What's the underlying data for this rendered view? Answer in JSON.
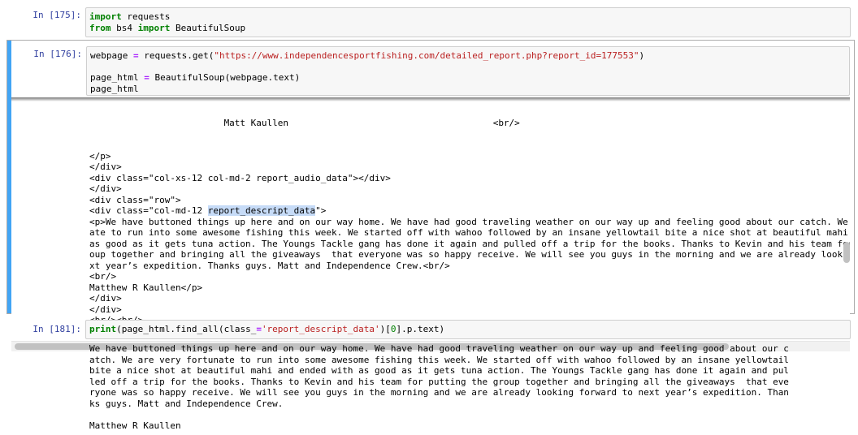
{
  "cells": [
    {
      "prompt": "In [175]:",
      "code": [
        [
          {
            "t": "import",
            "c": "kw"
          },
          {
            "t": " requests"
          }
        ],
        [
          {
            "t": "from",
            "c": "kw"
          },
          {
            "t": " bs4 "
          },
          {
            "t": "import",
            "c": "kw"
          },
          {
            "t": " BeautifulSoup"
          }
        ]
      ]
    },
    {
      "prompt": "In [176]:",
      "code": [
        [
          {
            "t": "webpage "
          },
          {
            "t": "=",
            "c": "op"
          },
          {
            "t": " requests.get("
          },
          {
            "t": "\"https://www.independencesportfishing.com/detailed_report.php?report_id=177553\"",
            "c": "str"
          },
          {
            "t": ")"
          }
        ],
        [
          {
            "t": ""
          }
        ],
        [
          {
            "t": "page_html "
          },
          {
            "t": "=",
            "c": "op"
          },
          {
            "t": " BeautifulSoup(webpage.text)"
          }
        ],
        [
          {
            "t": "page_html"
          }
        ]
      ],
      "output_partial_line": "                         Matt Kaullen                                      <br/>",
      "output_lines": [
        "</p>",
        "</div>",
        "<div class=\"col-xs-12 col-md-2 report_audio_data\"></div>",
        "</div>",
        "<div class=\"row\">",
        "<div class=\"col-md-12 ",
        "<p>We have buttoned things up here and on our way home. We have had good traveling weather on our way up and feeling good about our catch. We are very fortun",
        "ate to run into some awesome fishing this week. We started off with wahoo followed by an insane yellowtail bite a nice shot at beautiful mahi and ended with",
        "as good as it gets tuna action. The Youngs Tackle gang has done it again and pulled off a trip for the books. Thanks to Kevin and his team for putting the gr",
        "oup together and bringing all the giveaways  that everyone was so happy receive. We will see you guys in the morning and we are already looking forward to ne",
        "xt year’s expedition. Thanks guys. Matt and Independence Crew.<br/>",
        "<br/>",
        "Matthew R Kaullen</p>",
        "</div>",
        "</div>",
        "<br/><br/>",
        "</div>",
        "</div>"
      ],
      "highlight_text": "report_descript_data",
      "highlight_suffix": "\">"
    },
    {
      "prompt": "In [181]:",
      "code": [
        [
          {
            "t": "print",
            "c": "kw"
          },
          {
            "t": "(page_html.find_all(class_"
          },
          {
            "t": "=",
            "c": "op"
          },
          {
            "t": "'report_descript_data'",
            "c": "str"
          },
          {
            "t": ")["
          },
          {
            "t": "0",
            "c": "num"
          },
          {
            "t": "].p.text)"
          }
        ]
      ],
      "output_lines": [
        "We have buttoned things up here and on our way home. We have had good traveling weather on our way up and feeling good about our c",
        "atch. We are very fortunate to run into some awesome fishing this week. We started off with wahoo followed by an insane yellowtail",
        "bite a nice shot at beautiful mahi and ended with as good as it gets tuna action. The Youngs Tackle gang has done it again and pul",
        "led off a trip for the books. Thanks to Kevin and his team for putting the group together and bringing all the giveaways  that eve",
        "ryone was so happy receive. We will see you guys in the morning and we are already looking forward to next year’s expedition. Than",
        "ks guys. Matt and Independence Crew.",
        "",
        "Matthew R Kaullen"
      ]
    }
  ]
}
